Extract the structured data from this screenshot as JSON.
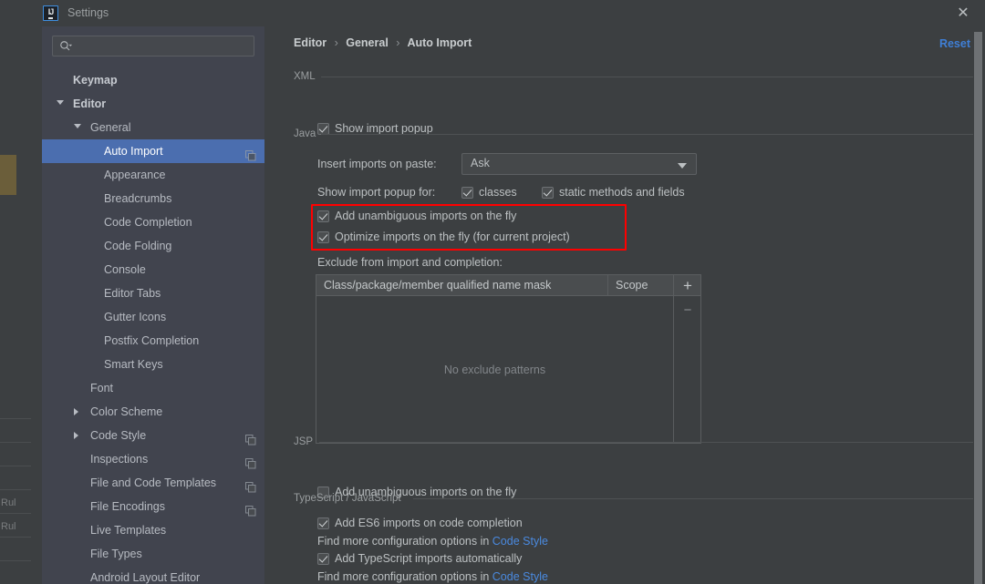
{
  "window": {
    "title": "Settings",
    "app_icon": "intellij-idea-icon",
    "close_icon": "close-icon"
  },
  "sidebar": {
    "search": {
      "placeholder": "",
      "value": "",
      "icon": "search-icon"
    },
    "items": [
      {
        "label": "Keymap",
        "indent": 34,
        "arrow": "none",
        "bold": true,
        "selected": false,
        "proj": false
      },
      {
        "label": "Editor",
        "indent": 34,
        "arrow": "down",
        "bold": true,
        "selected": false,
        "proj": false
      },
      {
        "label": "General",
        "indent": 53,
        "arrow": "down",
        "bold": false,
        "selected": false,
        "proj": false
      },
      {
        "label": "Auto Import",
        "indent": 68,
        "arrow": "none",
        "bold": false,
        "selected": true,
        "proj": true
      },
      {
        "label": "Appearance",
        "indent": 68,
        "arrow": "none",
        "bold": false,
        "selected": false,
        "proj": false
      },
      {
        "label": "Breadcrumbs",
        "indent": 68,
        "arrow": "none",
        "bold": false,
        "selected": false,
        "proj": false
      },
      {
        "label": "Code Completion",
        "indent": 68,
        "arrow": "none",
        "bold": false,
        "selected": false,
        "proj": false
      },
      {
        "label": "Code Folding",
        "indent": 68,
        "arrow": "none",
        "bold": false,
        "selected": false,
        "proj": false
      },
      {
        "label": "Console",
        "indent": 68,
        "arrow": "none",
        "bold": false,
        "selected": false,
        "proj": false
      },
      {
        "label": "Editor Tabs",
        "indent": 68,
        "arrow": "none",
        "bold": false,
        "selected": false,
        "proj": false
      },
      {
        "label": "Gutter Icons",
        "indent": 68,
        "arrow": "none",
        "bold": false,
        "selected": false,
        "proj": false
      },
      {
        "label": "Postfix Completion",
        "indent": 68,
        "arrow": "none",
        "bold": false,
        "selected": false,
        "proj": false
      },
      {
        "label": "Smart Keys",
        "indent": 68,
        "arrow": "none",
        "bold": false,
        "selected": false,
        "proj": false
      },
      {
        "label": "Font",
        "indent": 53,
        "arrow": "none",
        "bold": false,
        "selected": false,
        "proj": false
      },
      {
        "label": "Color Scheme",
        "indent": 53,
        "arrow": "right",
        "bold": false,
        "selected": false,
        "proj": false
      },
      {
        "label": "Code Style",
        "indent": 53,
        "arrow": "right",
        "bold": false,
        "selected": false,
        "proj": true
      },
      {
        "label": "Inspections",
        "indent": 53,
        "arrow": "none",
        "bold": false,
        "selected": false,
        "proj": true
      },
      {
        "label": "File and Code Templates",
        "indent": 53,
        "arrow": "none",
        "bold": false,
        "selected": false,
        "proj": true
      },
      {
        "label": "File Encodings",
        "indent": 53,
        "arrow": "none",
        "bold": false,
        "selected": false,
        "proj": true
      },
      {
        "label": "Live Templates",
        "indent": 53,
        "arrow": "none",
        "bold": false,
        "selected": false,
        "proj": false
      },
      {
        "label": "File Types",
        "indent": 53,
        "arrow": "none",
        "bold": false,
        "selected": false,
        "proj": false
      },
      {
        "label": "Android Layout Editor",
        "indent": 53,
        "arrow": "none",
        "bold": false,
        "selected": false,
        "proj": false
      }
    ]
  },
  "breadcrumb": {
    "part1": "Editor",
    "sep": "›",
    "part2": "General",
    "part3": "Auto Import"
  },
  "reset": {
    "label": "Reset",
    "color": "#3f7fd6"
  },
  "sections": {
    "xml": {
      "title": "XML",
      "show_import_popup": {
        "label": "Show import popup",
        "checked": true
      }
    },
    "java": {
      "title": "Java",
      "insert_imports_label": "Insert imports on paste:",
      "insert_imports_value": "Ask",
      "show_popup_for_label": "Show import popup for:",
      "classes": {
        "label": "classes",
        "checked": true
      },
      "static_methods": {
        "label": "static methods and fields",
        "checked": true
      },
      "add_unambiguous": {
        "label": "Add unambiguous imports on the fly",
        "checked": true
      },
      "optimize_imports": {
        "label": "Optimize imports on the fly (for current project)",
        "checked": true
      },
      "exclude_label": "Exclude from import and completion:",
      "table": {
        "columns": [
          "Class/package/member qualified name mask",
          "Scope"
        ],
        "rows": [],
        "empty_text": "No exclude patterns",
        "add_button": "+",
        "remove_button": "−"
      }
    },
    "jsp": {
      "title": "JSP",
      "add_unambiguous": {
        "label": "Add unambiguous imports on the fly",
        "checked": false
      }
    },
    "ts_js": {
      "title": "TypeScript / JavaScript",
      "es6": {
        "label": "Add ES6 imports on code completion",
        "checked": true
      },
      "es6_hint_prefix": "Find more configuration options in ",
      "es6_hint_link": "Code Style",
      "ts_auto": {
        "label": "Add TypeScript imports automatically",
        "checked": true
      },
      "ts_hint_prefix": "Find more configuration options in ",
      "ts_hint_link": "Code Style"
    }
  },
  "background_window": {
    "text1": "Rul",
    "text2": "Rul"
  },
  "colors": {
    "accent_selection": "#4b6eaf",
    "link": "#4a8ae0",
    "annotation_red": "#ff0000",
    "dialog_bg": "#3c3f41",
    "sidebar_bg": "#41444e"
  }
}
